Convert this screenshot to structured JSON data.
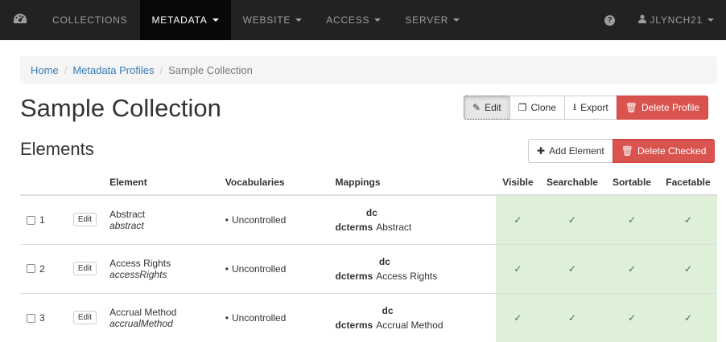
{
  "navbar": {
    "items": [
      {
        "label": "COLLECTIONS",
        "caret": false,
        "active": false
      },
      {
        "label": "METADATA",
        "caret": true,
        "active": true
      },
      {
        "label": "WEBSITE",
        "caret": true,
        "active": false
      },
      {
        "label": "ACCESS",
        "caret": true,
        "active": false
      },
      {
        "label": "SERVER",
        "caret": true,
        "active": false
      }
    ],
    "help_glyph": "?",
    "user": "JLYNCH21",
    "brand_icon": "tachometer-icon"
  },
  "breadcrumb": {
    "items": [
      "Home",
      "Metadata Profiles",
      "Sample Collection"
    ],
    "separator": "/"
  },
  "page": {
    "title": "Sample Collection"
  },
  "toolbar": {
    "edit": "Edit",
    "clone": "Clone",
    "export": "Export",
    "delete_profile": "Delete Profile"
  },
  "elements": {
    "title": "Elements",
    "add_element": "Add Element",
    "delete_checked": "Delete Checked"
  },
  "table": {
    "headers": {
      "element": "Element",
      "vocabularies": "Vocabularies",
      "mappings": "Mappings",
      "visible": "Visible",
      "searchable": "Searchable",
      "sortable": "Sortable",
      "facetable": "Facetable"
    },
    "edit_label": "Edit",
    "check_glyph": "✓",
    "rows": [
      {
        "index": "1",
        "label": "Abstract",
        "name": "abstract",
        "vocabulary": "Uncontrolled",
        "dc": "dc",
        "dcterms_ns": "dcterms",
        "dcterms_value": "Abstract"
      },
      {
        "index": "2",
        "label": "Access Rights",
        "name": "accessRights",
        "vocabulary": "Uncontrolled",
        "dc": "dc",
        "dcterms_ns": "dcterms",
        "dcterms_value": "Access Rights"
      },
      {
        "index": "3",
        "label": "Accrual Method",
        "name": "accrualMethod",
        "vocabulary": "Uncontrolled",
        "dc": "dc",
        "dcterms_ns": "dcterms",
        "dcterms_value": "Accrual Method"
      }
    ]
  },
  "colors": {
    "navbar_bg": "#222222",
    "navbar_active": "#080808",
    "link": "#337ab7",
    "danger": "#d9534f",
    "success_bg": "#dff0d8"
  }
}
